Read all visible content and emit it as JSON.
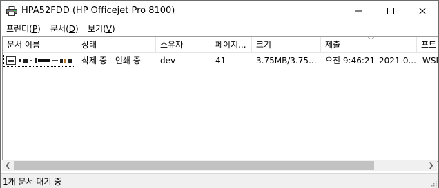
{
  "window": {
    "title": "HPA52FDD (HP Officejet Pro 8100)",
    "minimize_glyph": "—",
    "maximize_glyph": "☐",
    "close_glyph": "✕"
  },
  "menu": {
    "items": [
      {
        "label": "프린터(",
        "key": "P",
        "suffix": ")"
      },
      {
        "label": "문서(",
        "key": "D",
        "suffix": ")"
      },
      {
        "label": "보기(",
        "key": "V",
        "suffix": ")"
      }
    ]
  },
  "table": {
    "columns": [
      "문서 이름",
      "상태",
      "소유자",
      "페이지...",
      "크기",
      "제출",
      "포트"
    ],
    "rows": [
      {
        "name": "",
        "status": "삭제 중 - 인쇄 중",
        "owner": "dev",
        "pages": "41",
        "size": "3.75MB/3.75...",
        "submitted_time": "오전 9:46:21",
        "submitted_date": "2021-0...",
        "port": "WSD"
      }
    ]
  },
  "status": {
    "text": "1개 문서 대기 중"
  },
  "icons": {
    "title": "printer-icon",
    "document": "document-icon"
  }
}
